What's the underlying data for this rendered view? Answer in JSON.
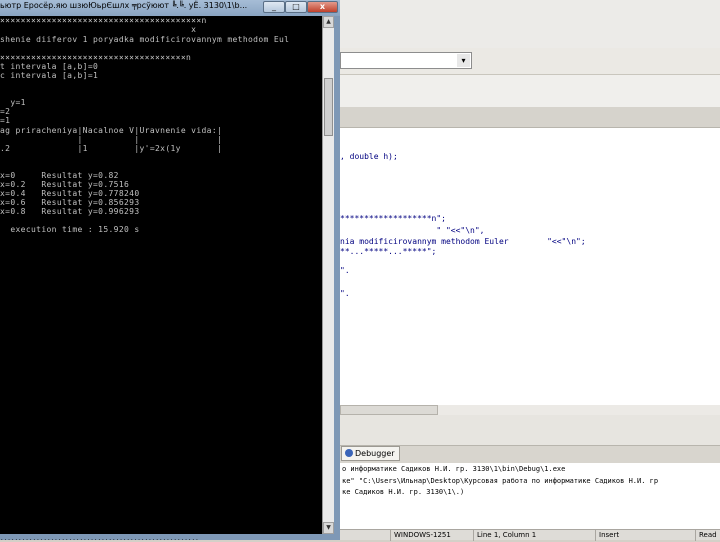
{
  "console": {
    "title": "ьютр  Ероcёр.яю шзюЮьрЄшлх ╤рсўюют ╚.╚. уЁ. 3130\\1\\b...",
    "min_glyph": "_",
    "max_glyph": "□",
    "close_glyph": "x",
    "lines": [
      "×××××××××××××××××××××××××××××××××××××××n",
      "                                     x",
      "shenie diiferov 1 poryadka modificirovannym methodom Eul",
      "",
      "××××××××××××××××××××××××××××××××××××n",
      "t intervala [a,b]=0",
      "c intervala [a,b]=1",
      "",
      "",
      "  y=1",
      "=2",
      "=1",
      "ag priracheniya|Nacalnoe V|Uravnenie vida:|",
      "               |          |               |",
      ".2             |1         |y'=2x(1y       |",
      "",
      "",
      "x=0     Resultat y=0.82",
      "x=0.2   Resultat y=0.7516",
      "x=0.4   Resultat y=0.778240",
      "x=0.6   Resultat y=0.856293",
      "x=0.8   Resultat y=0.996293",
      "",
      "  execution time : 15.920 s",
      ""
    ],
    "status_text": "......................................................."
  },
  "ide": {
    "scope_value": "",
    "scope_arrow": "▾",
    "code_lines": [
      ", double h);",
      "",
      "",
      "",
      "",
      "",
      "*******************n\";",
      "                    \" \"<<\"\\n\",",
      "nia modificirovannym methodom Euler        \"<<\"\\n\";",
      "**...*****...*****\";",
      "",
      "\".",
      "",
      "",
      "\"."
    ],
    "debugger_tab": "Debugger",
    "log_lines": [
      "о информатике Садиков Н.И. гр. 3130\\1\\bin\\Debug\\1.exe",
      "ке\" \"C:\\Users\\Ильнар\\Desktop\\Курсовая работа по информатике Садиков Н.И. гр",
      "ке Садиков Н.И. гр. 3130\\1\\.)"
    ],
    "status": {
      "encoding": "WINDOWS-1251",
      "position": "Line 1, Column 1",
      "mode": "Insert",
      "state": "Read"
    }
  }
}
